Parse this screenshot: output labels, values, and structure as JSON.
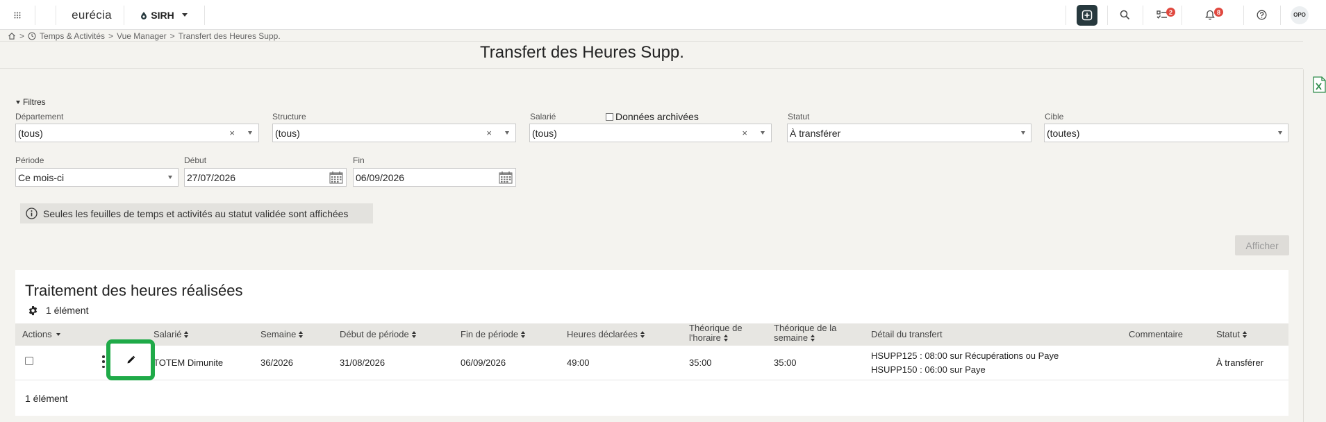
{
  "topbar": {
    "logo": "eurécia",
    "module": "SIRH",
    "tasks_badge": "2",
    "notifications_badge": "8",
    "avatar_initials": "OPO",
    "accent_color": "#27393e"
  },
  "breadcrumb": {
    "items": [
      "Temps & Activités",
      "Vue Manager",
      "Transfert des Heures Supp."
    ],
    "separator": ">"
  },
  "page": {
    "title": "Transfert des Heures Supp."
  },
  "filters": {
    "toggle_label": "Filtres",
    "departement": {
      "label": "Département",
      "value": "(tous)"
    },
    "structure": {
      "label": "Structure",
      "value": "(tous)"
    },
    "salarie": {
      "label": "Salarié",
      "value": "(tous)"
    },
    "archived": {
      "label": "Données archivées",
      "checked": false
    },
    "statut": {
      "label": "Statut",
      "value": "À transférer"
    },
    "cible": {
      "label": "Cible",
      "value": "(toutes)"
    },
    "periode": {
      "label": "Période",
      "value": "Ce mois-ci"
    },
    "debut": {
      "label": "Début",
      "value": "27/07/2026"
    },
    "fin": {
      "label": "Fin",
      "value": "06/09/2026"
    }
  },
  "info_message": "Seules les feuilles de temps et activités au statut validée sont affichées",
  "afficher_label": "Afficher",
  "results": {
    "title": "Traitement des heures réalisées",
    "count_label": "1 élément",
    "footer_count": "1 élément",
    "columns": {
      "actions": "Actions",
      "salarie": "Salarié",
      "semaine": "Semaine",
      "debut": "Début de période",
      "fin": "Fin de période",
      "heures": "Heures déclarées",
      "theo_horaire_1": "Théorique de",
      "theo_horaire_2": "l'horaire",
      "theo_semaine_1": "Théorique de la",
      "theo_semaine_2": "semaine",
      "detail": "Détail du transfert",
      "commentaire": "Commentaire",
      "statut": "Statut"
    },
    "rows": [
      {
        "salarie": "TOTEM Dimunite",
        "semaine": "36/2026",
        "debut": "31/08/2026",
        "fin": "06/09/2026",
        "heures": "49:00",
        "theo_horaire": "35:00",
        "theo_semaine": "35:00",
        "detail_1": "HSUPP125 : 08:00 sur Récupérations ou Paye",
        "detail_2": "HSUPP150 : 06:00 sur Paye",
        "commentaire": "",
        "statut": "À transférer"
      }
    ]
  },
  "highlight_color": "#1faa48"
}
